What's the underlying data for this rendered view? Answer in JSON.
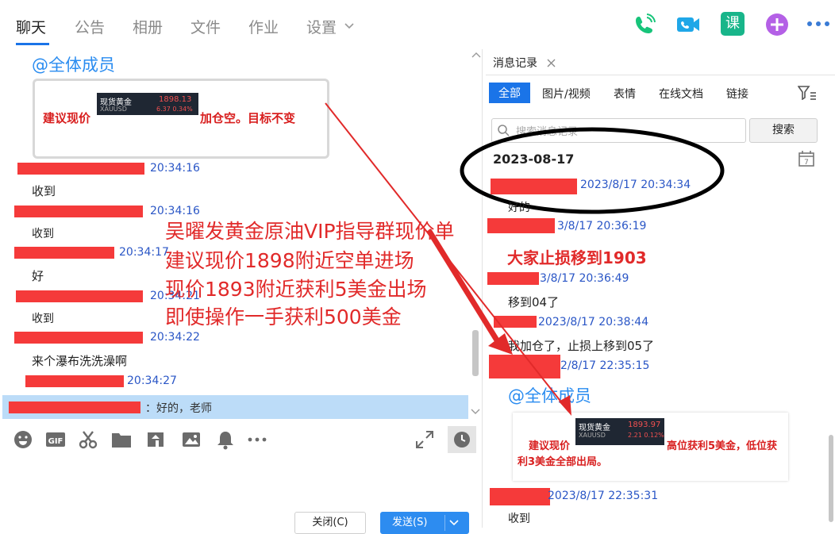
{
  "tabs": [
    {
      "label": "聊天",
      "active": true
    },
    {
      "label": "公告"
    },
    {
      "label": "相册"
    },
    {
      "label": "文件"
    },
    {
      "label": "作业"
    },
    {
      "label": "设置"
    }
  ],
  "header_icons": [
    "phone-icon",
    "video-call-icon",
    "course-icon",
    "add-app-icon",
    "more-icon"
  ],
  "course_glyph": "课",
  "chat": {
    "at_all": "@全体成员",
    "image1": {
      "left": "建议现价",
      "right": "加仓空。目标不变",
      "widget_name": "现货黄金",
      "widget_code": "XAUUSD",
      "widget_price": "1898.13",
      "widget_change": "6.37  0.34%"
    },
    "messages": [
      {
        "time": "20:34:16",
        "text": "收到"
      },
      {
        "time": "20:34:16",
        "text": "收到"
      },
      {
        "time": "20:34:17",
        "text": "好"
      },
      {
        "time": "20:34:21",
        "text": "收到"
      },
      {
        "time": "20:34:22",
        "text": "来个瀑布洗洗澡啊"
      },
      {
        "time": "20:34:27",
        "text": ""
      }
    ],
    "quote_text": "：好的，老师"
  },
  "overlay_lines": [
    "吴曜发黄金原油VIP指导群现价单",
    "建议现价1898附近空单进场",
    "现价1893附近获利5美金出场",
    "即使操作一手获利500美金"
  ],
  "toolbar": {
    "close_label": "关闭(C)",
    "send_label": "发送(S)"
  },
  "history": {
    "tab_label": "消息记录",
    "filters": [
      "全部",
      "图片/视频",
      "表情",
      "在线文档",
      "链接"
    ],
    "search_placeholder": "搜索消息记录",
    "search_button": "搜索",
    "date": "2023-08-17",
    "entries": [
      {
        "time": "2023/8/17 20:34:34",
        "text": "好的"
      },
      {
        "time": "3/8/17 20:36:19",
        "text": ""
      },
      {
        "time": "3/8/17 20:36:49",
        "text": "移到04了"
      },
      {
        "time": "2023/8/17 20:38:44",
        "text": "我加仓了，止损上移到05了"
      },
      {
        "time": "2/8/17 22:35:15",
        "text": ""
      },
      {
        "time": "2023/8/17 22:35:31",
        "text": "收到"
      }
    ],
    "callout": "大家止损移到1903",
    "at_all": "@全体成员",
    "image2": {
      "left": "建议现价",
      "left2": "利3美金全部出局。",
      "right": "高位获利5美金，低位获",
      "widget_name": "现货黄金",
      "widget_code": "XAUUSD",
      "widget_price": "1893.97",
      "widget_change": "2.21  0.12%"
    }
  },
  "colors": {
    "accent": "#1a74e8",
    "red_mark": "#f53a3a",
    "overlay_red": "#e12a2a",
    "timestamp_blue": "#2a56c6"
  }
}
